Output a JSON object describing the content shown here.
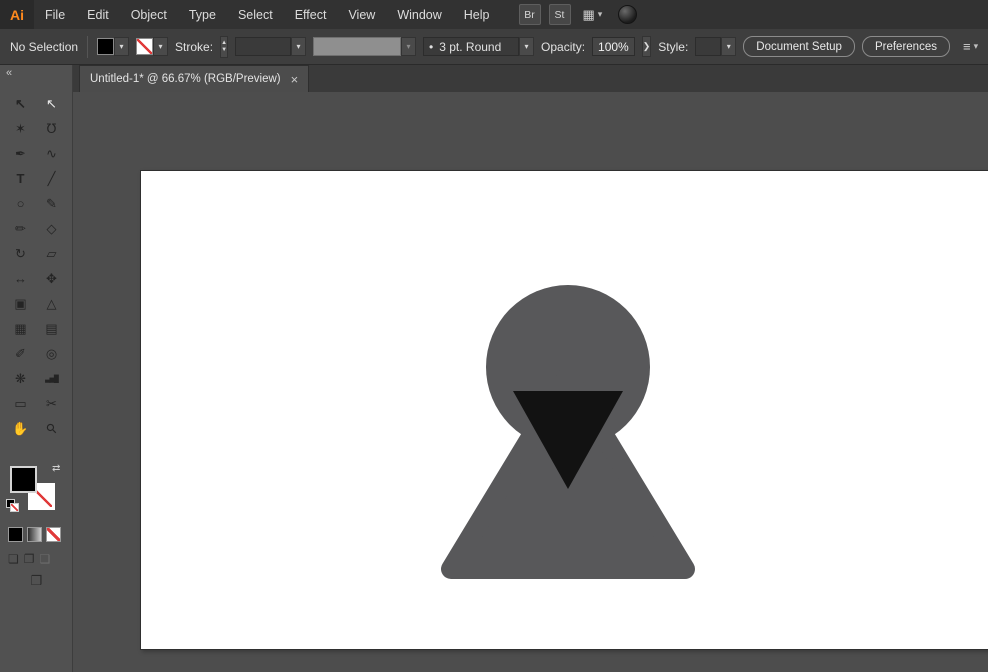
{
  "app": {
    "logo_text": "Ai"
  },
  "menubar": {
    "items": [
      "File",
      "Edit",
      "Object",
      "Type",
      "Select",
      "Effect",
      "View",
      "Window",
      "Help"
    ],
    "br_button": "Br",
    "st_button": "St"
  },
  "control_bar": {
    "selection_status": "No Selection",
    "stroke_label": "Stroke:",
    "brush_bullet": "•",
    "brush_value": "3 pt. Round",
    "opacity_label": "Opacity:",
    "opacity_value": "100%",
    "style_label": "Style:",
    "document_setup_button": "Document Setup",
    "preferences_button": "Preferences"
  },
  "tab_bar": {
    "collapse_glyph": "«",
    "tab_title": "Untitled-1* @ 66.67% (RGB/Preview)",
    "close_glyph": "×"
  },
  "icons": {
    "chevron": "▾",
    "stepper_up": "▲",
    "stepper_down": "▼",
    "swap": "⇄",
    "flyout": "❯",
    "workspace": "▦",
    "align": "≡",
    "draw_normal": "❏",
    "draw_behind": "❐",
    "draw_inside": "❑",
    "screen_mode": "❒"
  },
  "tools": [
    {
      "name": "selection-tool",
      "glyph": "↖",
      "cls": "t-bold"
    },
    {
      "name": "direct-selection-tool",
      "glyph": "↖",
      "cls": "t-white"
    },
    {
      "name": "magic-wand-tool",
      "glyph": "✶"
    },
    {
      "name": "lasso-tool",
      "glyph": "℧"
    },
    {
      "name": "pen-tool",
      "glyph": "✒"
    },
    {
      "name": "curvature-tool",
      "glyph": "∿"
    },
    {
      "name": "type-tool",
      "glyph": "T",
      "cls": "t-bold"
    },
    {
      "name": "line-segment-tool",
      "glyph": "╱"
    },
    {
      "name": "ellipse-tool",
      "glyph": "○"
    },
    {
      "name": "paintbrush-tool",
      "glyph": "✎"
    },
    {
      "name": "pencil-tool",
      "glyph": "✏"
    },
    {
      "name": "eraser-tool",
      "glyph": "◇"
    },
    {
      "name": "rotate-tool",
      "glyph": "↻"
    },
    {
      "name": "scale-tool",
      "glyph": "▱"
    },
    {
      "name": "width-tool",
      "glyph": "↔"
    },
    {
      "name": "free-transform-tool",
      "glyph": "✥"
    },
    {
      "name": "shape-builder-tool",
      "glyph": "▣"
    },
    {
      "name": "perspective-grid-tool",
      "glyph": "△"
    },
    {
      "name": "mesh-tool",
      "glyph": "▦"
    },
    {
      "name": "gradient-tool",
      "glyph": "▤"
    },
    {
      "name": "eyedropper-tool",
      "glyph": "✐"
    },
    {
      "name": "blend-tool",
      "glyph": "◎"
    },
    {
      "name": "symbol-sprayer-tool",
      "glyph": "❋"
    },
    {
      "name": "column-graph-tool",
      "glyph": "▃▅█",
      "cls": "t-graph"
    },
    {
      "name": "artboard-tool",
      "glyph": "▭"
    },
    {
      "name": "slice-tool",
      "glyph": "✂"
    },
    {
      "name": "hand-tool",
      "glyph": "✋"
    },
    {
      "name": "zoom-tool",
      "glyph": "⚲",
      "cls": "t-zoom"
    }
  ],
  "colors": {
    "accent_orange": "#ff8a1e",
    "hood_gray": "#58585a",
    "face_black": "#121212",
    "none_red": "#e03a3a",
    "artboard_white": "#ffffff"
  },
  "canvas": {
    "figure_name": "hooded-figure"
  }
}
